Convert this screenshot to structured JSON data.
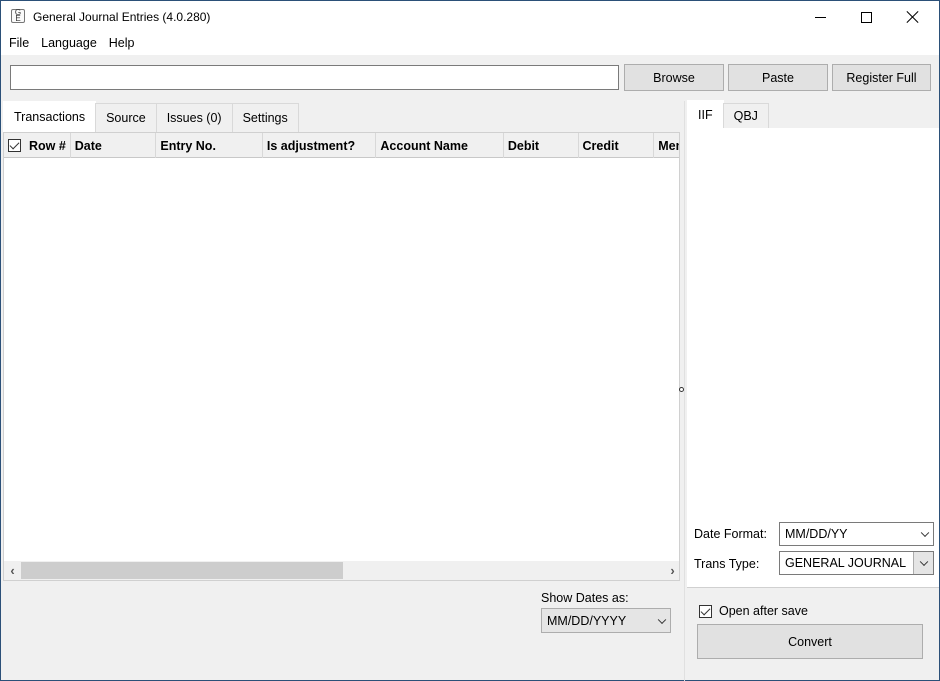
{
  "window": {
    "title": "General Journal Entries (4.0.280)",
    "app_icon": "app-logo-icon",
    "controls": {
      "minimize_icon": "minimize-icon",
      "maximize_icon": "maximize-icon",
      "close_icon": "close-icon"
    }
  },
  "menubar": {
    "items": [
      {
        "label": "File"
      },
      {
        "label": "Language"
      },
      {
        "label": "Help"
      }
    ]
  },
  "toolbar": {
    "path_value": "",
    "browse_label": "Browse",
    "paste_label": "Paste",
    "register_label": "Register Full"
  },
  "left_tabs": [
    {
      "label": "Transactions",
      "active": true
    },
    {
      "label": "Source",
      "active": false
    },
    {
      "label": "Issues (0)",
      "active": false
    },
    {
      "label": "Settings",
      "active": false
    }
  ],
  "grid": {
    "select_all_checked": true,
    "columns": [
      {
        "label": "Row #"
      },
      {
        "label": "Date"
      },
      {
        "label": "Entry No."
      },
      {
        "label": "Is adjustment?"
      },
      {
        "label": "Account Name"
      },
      {
        "label": "Debit"
      },
      {
        "label": "Credit"
      },
      {
        "label": "Memo"
      }
    ],
    "rows": [],
    "hscroll": {
      "left_icon": "chevron-left-icon",
      "right_icon": "chevron-right-icon"
    }
  },
  "show_dates": {
    "label": "Show Dates as:",
    "value": "MM/DD/YYYY"
  },
  "right_tabs": [
    {
      "label": "IIF",
      "active": true
    },
    {
      "label": "QBJ",
      "active": false
    }
  ],
  "output_settings": {
    "date_format_label": "Date Format:",
    "date_format_value": "MM/DD/YY",
    "trans_type_label": "Trans Type:",
    "trans_type_value": "GENERAL JOURNAL",
    "open_after_save_label": "Open after save",
    "open_after_save_checked": true,
    "convert_label": "Convert"
  }
}
